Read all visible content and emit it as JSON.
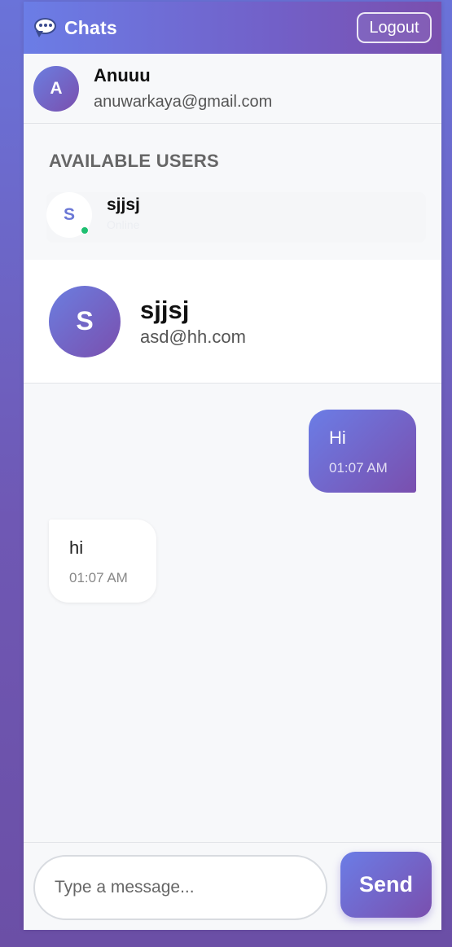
{
  "header": {
    "icon": "chat-bubble-icon",
    "title": "Chats",
    "logout_label": "Logout"
  },
  "current_user": {
    "initial": "A",
    "name": "Anuuu",
    "email": "anuwarkaya@gmail.com"
  },
  "users_section": {
    "title": "AVAILABLE USERS",
    "users": [
      {
        "initial": "S",
        "name": "sjjsj",
        "status": "Online",
        "online": true
      }
    ]
  },
  "chat": {
    "contact": {
      "initial": "S",
      "name": "sjjsj",
      "email": "asd@hh.com"
    },
    "messages": [
      {
        "direction": "sent",
        "text": "Hi",
        "time": "01:07 AM"
      },
      {
        "direction": "received",
        "text": "hi",
        "time": "01:07 AM"
      }
    ]
  },
  "composer": {
    "placeholder": "Type a message...",
    "value": "",
    "send_label": "Send"
  },
  "colors": {
    "accent_start": "#6b7de6",
    "accent_end": "#7a4fae",
    "online": "#1fbf71"
  }
}
